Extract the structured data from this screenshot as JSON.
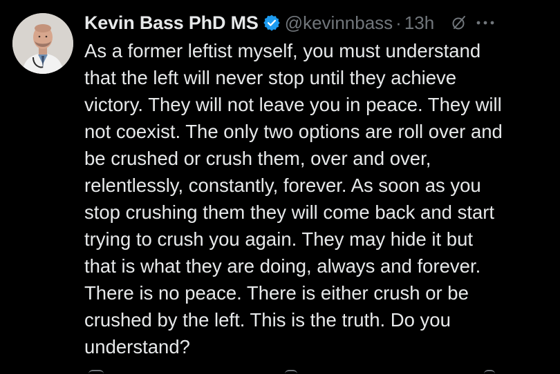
{
  "author": {
    "display_name": "Kevin Bass PhD MS",
    "handle": "@kevinnbass",
    "separator": "·",
    "timestamp": "13h",
    "verified_icon": "verified-badge-icon",
    "verified_color": "#1d9bf0"
  },
  "tweet": {
    "lines": [
      "As a former leftist myself, you must understand",
      "that the left will never stop until they achieve",
      "victory. They will not leave you in peace. They will",
      "not coexist. The only two options are roll over and",
      "be crushed or crush them, over and over,",
      "relentlessly, constantly, forever. As soon as you",
      "stop crushing them they will come back and start",
      "trying to crush you again. They may hide it but",
      "that is what they are doing, always and forever.",
      "There is no peace. There is either crush or be",
      "crushed by the left. This is the truth. Do you",
      "understand?"
    ]
  },
  "icons": {
    "grok": "grok-icon",
    "more": "more-options-icon"
  },
  "colors": {
    "background": "#000000",
    "text": "#e7e9ea",
    "secondary": "#71767b",
    "accent": "#1d9bf0"
  }
}
